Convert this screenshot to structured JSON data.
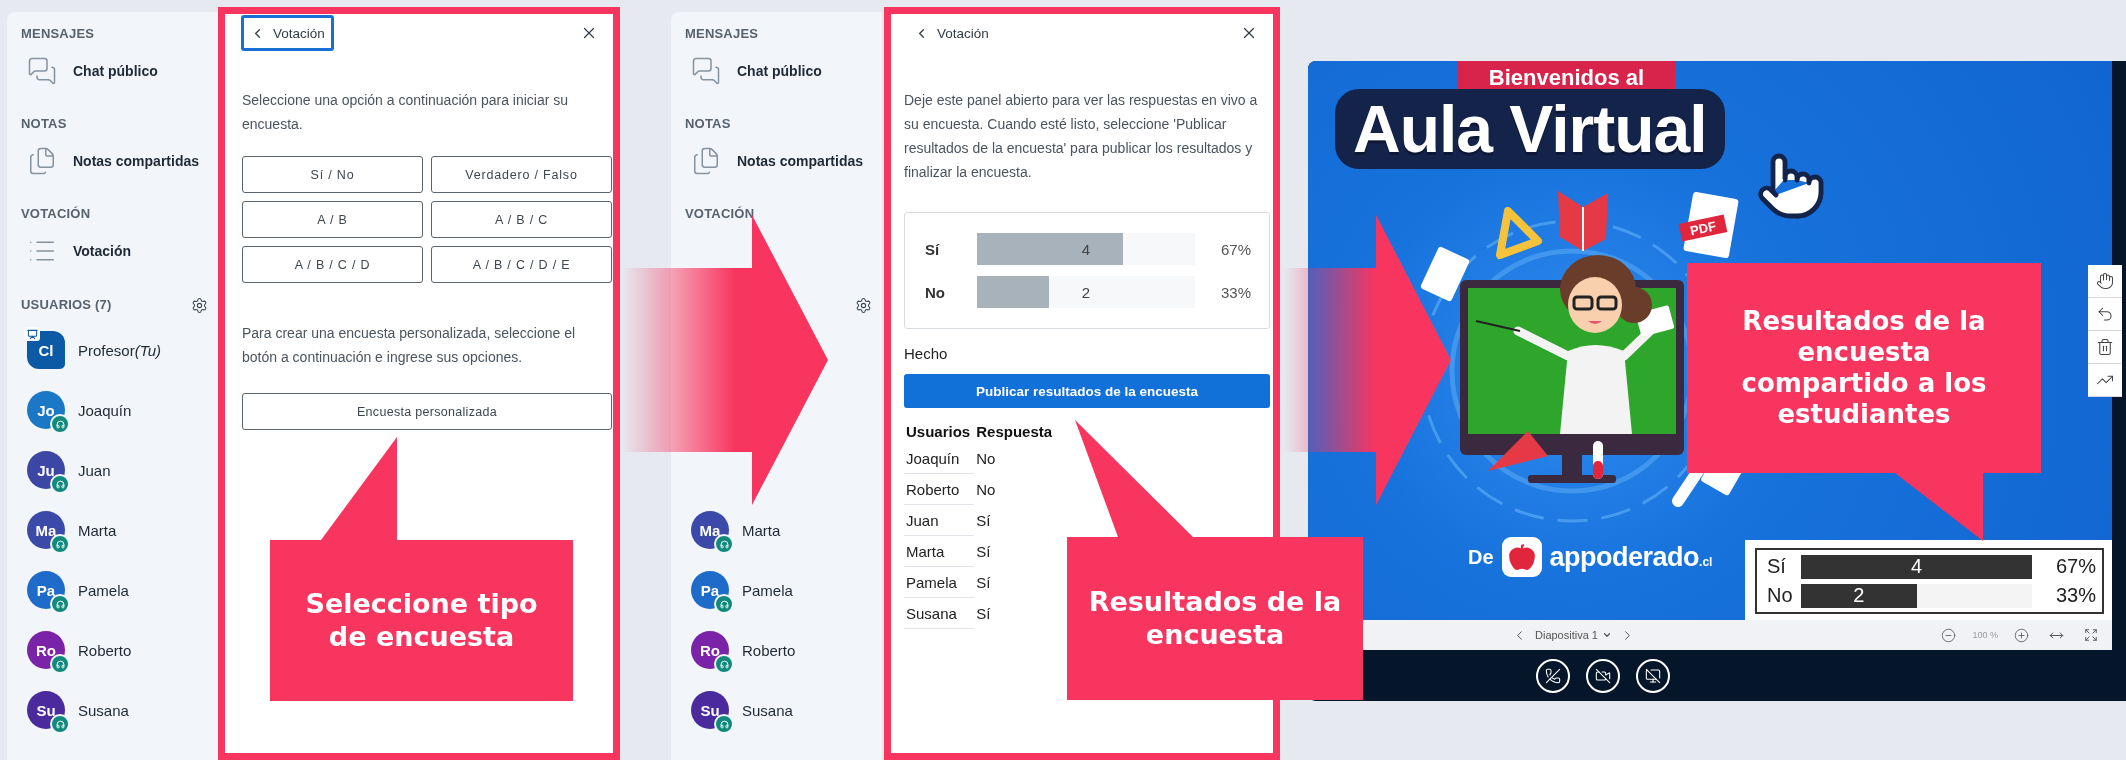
{
  "sidebars": [
    {
      "sections": [
        {
          "heading": "MENSAJES",
          "items": [
            {
              "kind": "chat",
              "label": "Chat público"
            }
          ]
        },
        {
          "heading": "NOTAS",
          "items": [
            {
              "kind": "notes",
              "label": "Notas compartidas"
            }
          ]
        },
        {
          "heading": "VOTACIÓN",
          "items": [
            {
              "kind": "poll",
              "label": "Votación"
            }
          ]
        }
      ],
      "users_heading": "USUARIOS (7)",
      "users": [
        {
          "kind": "presenter",
          "initials": "Cl",
          "name": "Profesor",
          "suffix": "(Tu)",
          "color": "#0c5aa6"
        },
        {
          "kind": "listener",
          "initials": "Jo",
          "name": "Joaquín",
          "color": "#1b78c6"
        },
        {
          "kind": "listener",
          "initials": "Ju",
          "name": "Juan",
          "color": "#3c46a4"
        },
        {
          "kind": "listener",
          "initials": "Ma",
          "name": "Marta",
          "color": "#3b4aa8"
        },
        {
          "kind": "listener",
          "initials": "Pa",
          "name": "Pamela",
          "color": "#1f6bc9"
        },
        {
          "kind": "listener",
          "initials": "Ro",
          "name": "Roberto",
          "color": "#7a22a8"
        },
        {
          "kind": "listener",
          "initials": "Su",
          "name": "Susana",
          "color": "#4a2a9c"
        }
      ]
    },
    {
      "sections": [
        {
          "heading": "MENSAJES",
          "items": [
            {
              "kind": "chat",
              "label": "Chat público"
            }
          ]
        },
        {
          "heading": "NOTAS",
          "items": [
            {
              "kind": "notes",
              "label": "Notas compartidas"
            }
          ]
        },
        {
          "heading": "VOTACIÓN"
        }
      ],
      "users": [
        {
          "kind": "listener",
          "initials": "Ma",
          "name": "Marta",
          "color": "#3b4aa8"
        },
        {
          "kind": "listener",
          "initials": "Pa",
          "name": "Pamela",
          "color": "#1f6bc9"
        },
        {
          "kind": "listener",
          "initials": "Ro",
          "name": "Roberto",
          "color": "#7a22a8"
        },
        {
          "kind": "listener",
          "initials": "Su",
          "name": "Susana",
          "color": "#4a2a9c"
        }
      ]
    }
  ],
  "poll_setup_panel": {
    "title": "Votación",
    "focused": true,
    "intro": "Seleccione una opción a continuación para iniciar su encuesta.",
    "options": [
      "Sí / No",
      "Verdadero / Falso",
      "A / B",
      "A / B / C",
      "A / B / C / D",
      "A / B / C / D / E"
    ],
    "custom_intro": "Para crear una encuesta personalizada, seleccione el botón a continuación e ingrese sus opciones.",
    "custom_button": "Encuesta personalizada"
  },
  "poll_results_panel": {
    "title": "Votación",
    "intro": "Deje este panel abierto para ver las respuestas en vivo a su encuesta. Cuando esté listo, seleccione 'Publicar resultados de la encuesta' para publicar los resultados y finalizar la encuesta.",
    "results": [
      {
        "label": "Sí",
        "count": "4",
        "percent": "67%",
        "level": 0.67
      },
      {
        "label": "No",
        "count": "2",
        "percent": "33%",
        "level": 0.33
      }
    ],
    "status": "Hecho",
    "publish_button": "Publicar resultados de la encuesta",
    "responses": {
      "columns": [
        "Usuarios",
        "Respuesta"
      ],
      "rows": [
        {
          "user": "Joaquín",
          "answer": "No"
        },
        {
          "user": "Roberto",
          "answer": "No"
        },
        {
          "user": "Juan",
          "answer": "Sí"
        },
        {
          "user": "Marta",
          "answer": "Sí"
        },
        {
          "user": "Pamela",
          "answer": "Sí"
        },
        {
          "user": "Susana",
          "answer": "Sí"
        }
      ]
    }
  },
  "presentation": {
    "slide": {
      "banner": "Bienvenidos al",
      "title": "Aula Virtual",
      "pdf_label": "PDF",
      "credit_prefix": "De",
      "brand": "appoderado",
      "brand_suffix": ".cl"
    },
    "results_overlay": [
      {
        "label": "Sí",
        "count": "4",
        "percent": "67%",
        "level": 1
      },
      {
        "label": "No",
        "count": "2",
        "percent": "33%",
        "level": 0.5
      }
    ],
    "slide_label": "Diapositiva 1",
    "zoom": "100 %"
  },
  "callouts": [
    {
      "text": "Seleccione tipo de encuesta"
    },
    {
      "text": "Resultados de la encuesta"
    },
    {
      "text": "Resultados de la encuesta compartido a los estudiantes"
    }
  ]
}
